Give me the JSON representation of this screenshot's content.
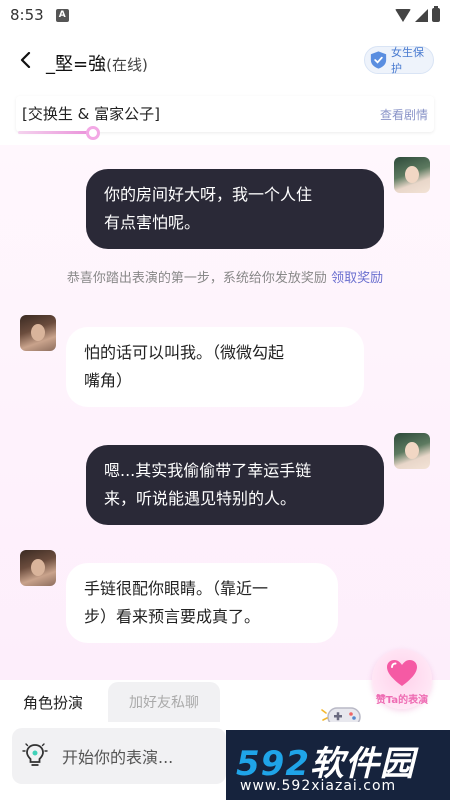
{
  "status_bar": {
    "time": "8:53",
    "badge": "A"
  },
  "header": {
    "title": "_堅=強",
    "status": "(在线)",
    "protect_label": "女生保护"
  },
  "scene": {
    "title": "[交换生 & 富家公子]",
    "link": "查看剧情",
    "progress": 0.2
  },
  "messages": [
    {
      "from": "me",
      "line1": "你的房间好大呀，我一个人住",
      "line2": "有点害怕呢。"
    },
    {
      "from": "them",
      "line1": "怕的话可以叫我。（微微勾起",
      "line2": "嘴角）"
    },
    {
      "from": "me",
      "line1": "嗯...其实我偷偷带了幸运手链",
      "line2": "来，听说能遇见特别的人。"
    },
    {
      "from": "them",
      "line1": "手链很配你眼睛。（靠近一",
      "line2": "步）看来预言要成真了。"
    }
  ],
  "system": {
    "text": "恭喜你踏出表演的第一步，系统给你发放奖励",
    "reward": "领取奖励"
  },
  "fab": {
    "label": "赞Ta的表演"
  },
  "tabs": {
    "active": "角色扮演",
    "inactive": "加好友私聊"
  },
  "input": {
    "placeholder": "开始你的表演..."
  },
  "watermark": {
    "num": "592",
    "cn": "软件园",
    "url": "www.592xiazai.com"
  },
  "colors": {
    "accent": "#6a6fcf",
    "bubble_me": "#2a2937",
    "pink": "#ee6cb3"
  }
}
